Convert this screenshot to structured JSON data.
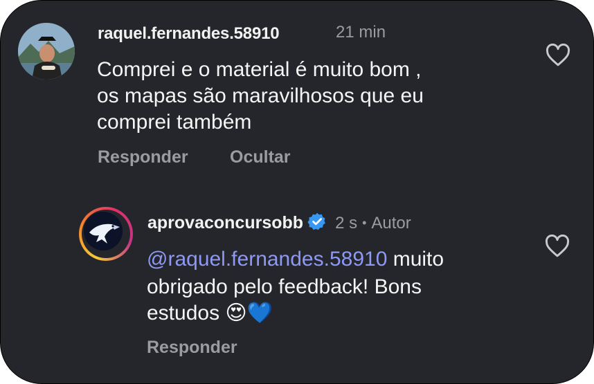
{
  "comment": {
    "username": "raquel.fernandes.58910",
    "time": "21 min",
    "line1": "Comprei e o material é muito bom ,",
    "line2": "os mapas são maravilhosos que eu",
    "line3": "comprei também",
    "reply_label": "Responder",
    "hide_label": "Ocultar"
  },
  "reply": {
    "username": "aprovaconcursobb",
    "time": "2 s",
    "separator": "•",
    "author_label": "Autor",
    "mention": "@raquel.fernandes.58910",
    "line1_rest": " muito",
    "line2": "obrigado pelo feedback! Bons",
    "line3": "estudos",
    "emojis": "😍💙",
    "reply_label": "Responder"
  },
  "colors": {
    "background": "#25262b",
    "mention": "#8e98f5",
    "muted": "#9b9ca1",
    "verified": "#3897f0"
  },
  "icons": [
    "heart-icon",
    "verified-badge-icon",
    "eagle-logo-icon"
  ]
}
